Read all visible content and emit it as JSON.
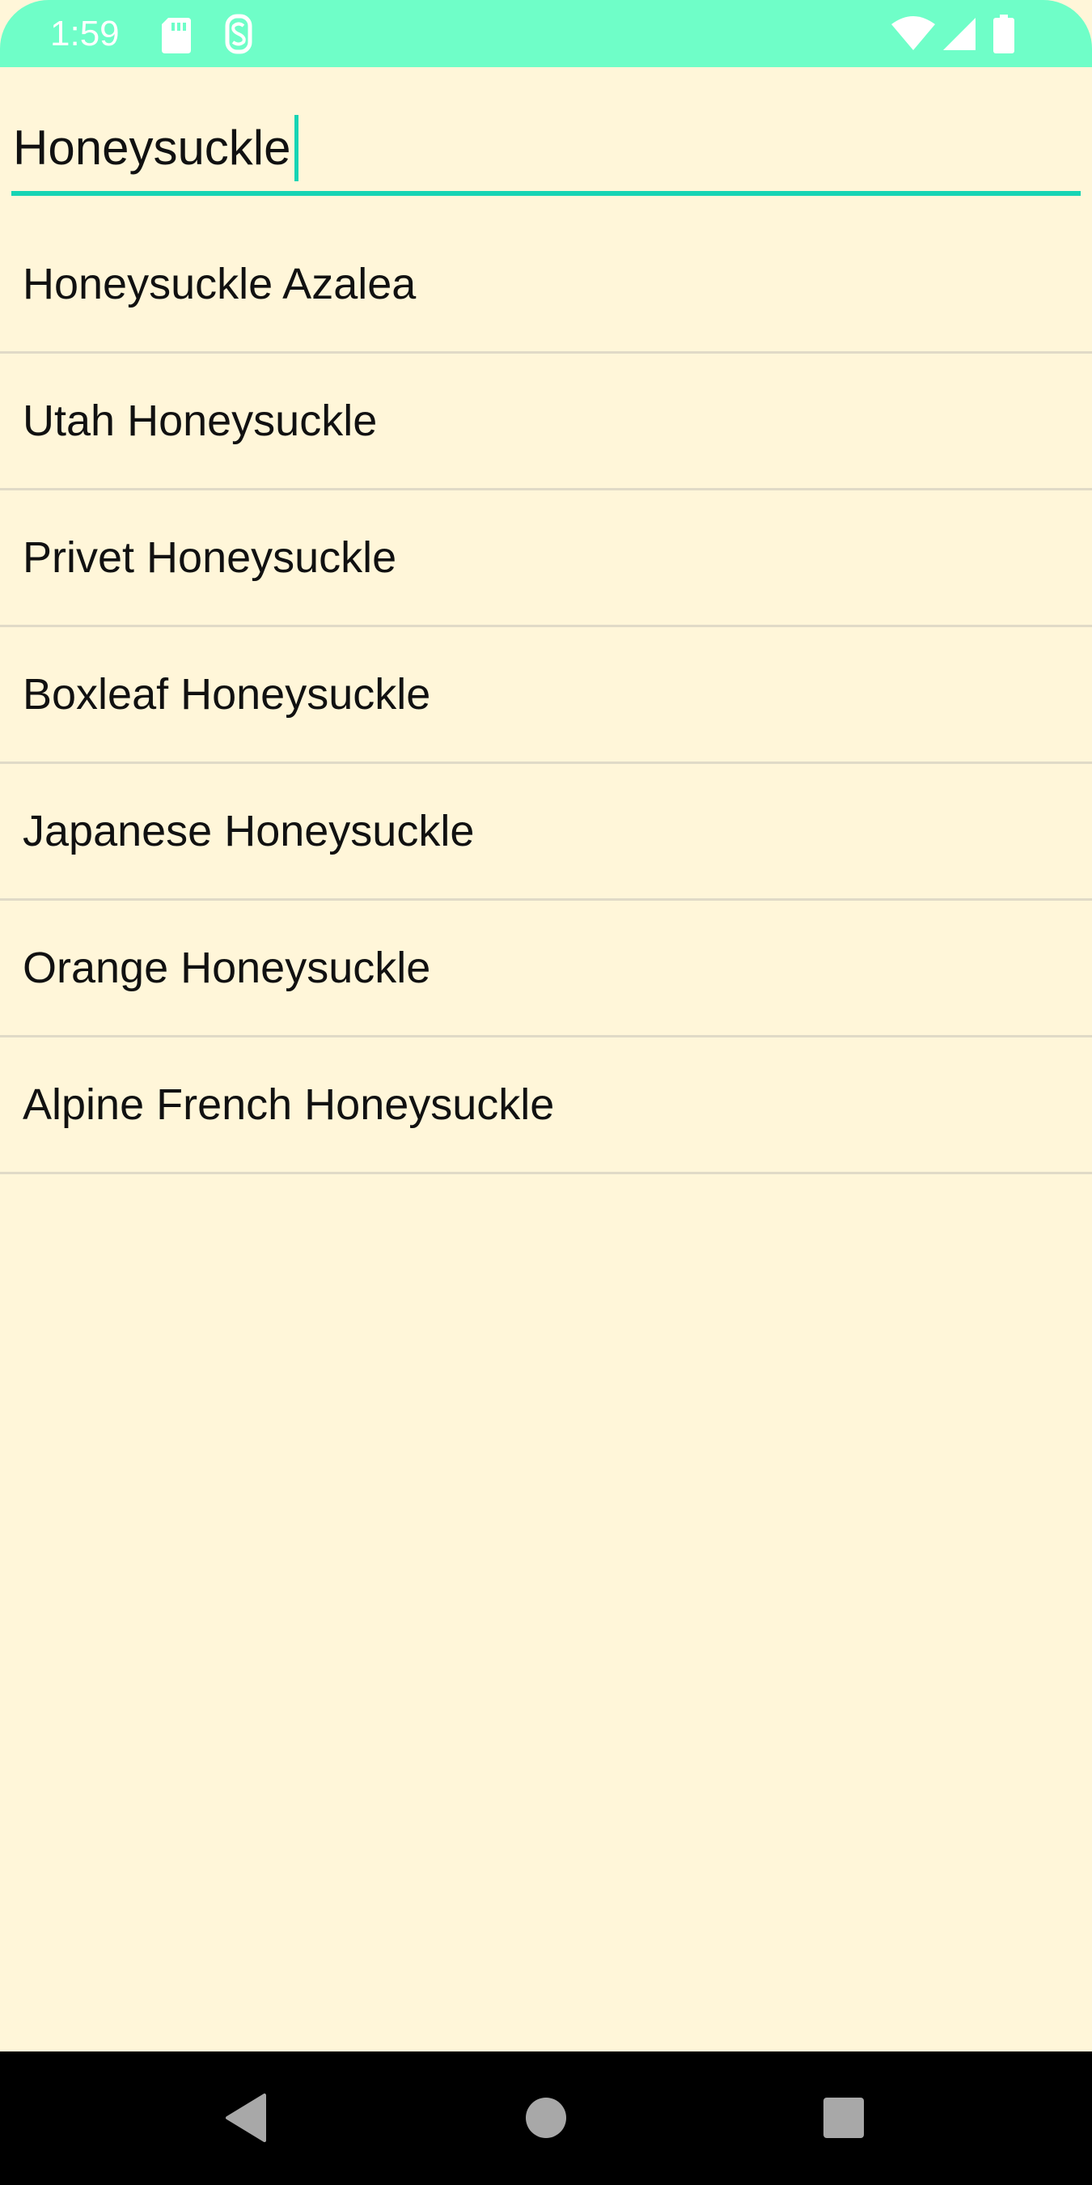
{
  "status_bar": {
    "time": "1:59",
    "icons": [
      "sd-card-icon",
      "s-notification-icon",
      "wifi-icon",
      "cell-signal-icon",
      "battery-icon"
    ],
    "background_color": "#6ffec8"
  },
  "search": {
    "value": "Honeysuckle",
    "accent_color": "#17d4b4"
  },
  "results": [
    {
      "label": "Honeysuckle Azalea"
    },
    {
      "label": "Utah Honeysuckle"
    },
    {
      "label": "Privet Honeysuckle"
    },
    {
      "label": "Boxleaf Honeysuckle"
    },
    {
      "label": "Japanese Honeysuckle"
    },
    {
      "label": "Orange Honeysuckle"
    },
    {
      "label": "Alpine French Honeysuckle"
    }
  ],
  "nav_bar": {
    "buttons": [
      "back-icon",
      "home-icon",
      "recents-icon"
    ]
  },
  "colors": {
    "background": "#fff6d9",
    "divider": "#e0dac7"
  }
}
